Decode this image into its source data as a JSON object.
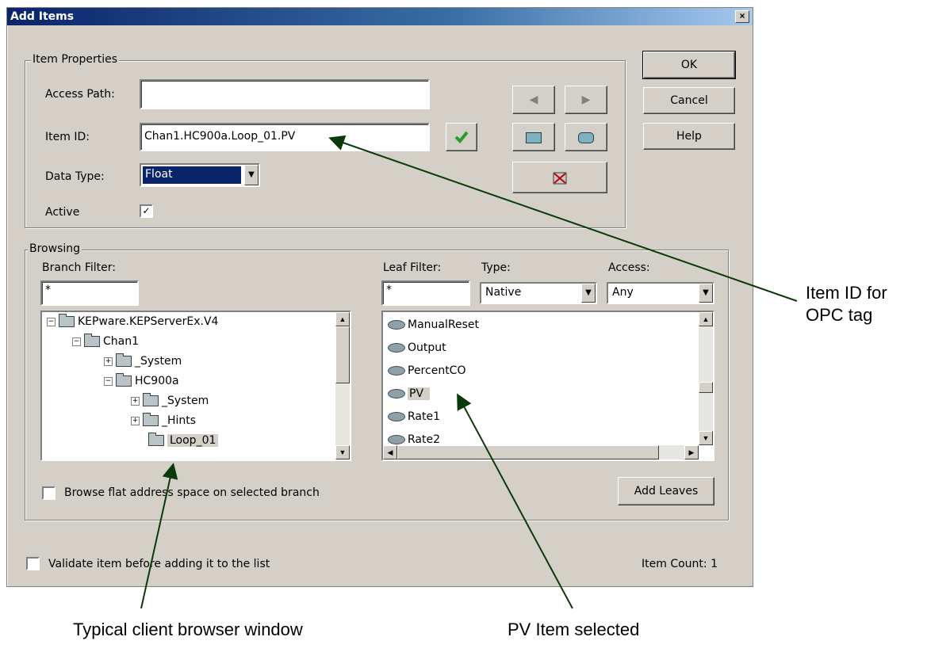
{
  "dialog": {
    "title": "Add Items",
    "close_glyph": "×"
  },
  "item_properties": {
    "group_label": "Item Properties",
    "access_path_label": "Access Path:",
    "access_path_value": "",
    "item_id_label": "Item ID:",
    "item_id_value": "Chan1.HC900a.Loop_01.PV",
    "data_type_label": "Data Type:",
    "data_type_value": "Float",
    "active_label": "Active",
    "active_checked": true
  },
  "buttons": {
    "ok": "OK",
    "cancel": "Cancel",
    "help": "Help",
    "add_leaves": "Add Leaves"
  },
  "browsing": {
    "group_label": "Browsing",
    "branch_filter_label": "Branch Filter:",
    "branch_filter_value": "*",
    "leaf_filter_label": "Leaf Filter:",
    "leaf_filter_value": "*",
    "type_label": "Type:",
    "type_value": "Native",
    "access_label": "Access:",
    "access_value": "Any",
    "tree": [
      {
        "label": "KEPware.KEPServerEx.V4",
        "expander": "−"
      },
      {
        "label": "Chan1",
        "expander": "−"
      },
      {
        "label": "_System",
        "expander": "+"
      },
      {
        "label": "HC900a",
        "expander": "−"
      },
      {
        "label": "_System",
        "expander": "+"
      },
      {
        "label": "_Hints",
        "expander": "+"
      },
      {
        "label": "Loop_01",
        "expander": ""
      }
    ],
    "leaves": [
      "ManualReset",
      "Output",
      "PercentCO",
      "PV",
      "Rate1",
      "Rate2"
    ],
    "browse_flat_label": "Browse flat address space on selected branch"
  },
  "footer": {
    "validate_label": "Validate item before adding it to the list",
    "item_count": "Item Count: 1"
  },
  "annotations": {
    "item_id_note_line1": "Item ID for",
    "item_id_note_line2": "OPC tag",
    "browser_note": "Typical client browser window",
    "pv_note": "PV Item selected"
  }
}
